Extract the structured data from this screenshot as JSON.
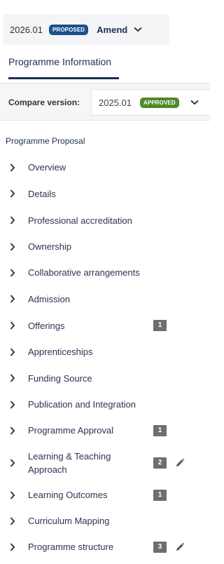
{
  "version_selector": {
    "version": "2026.01",
    "status_badge": "PROPOSED",
    "action_label": "Amend",
    "icon": "chevron-down-icon"
  },
  "tab": {
    "label": "Programme Information"
  },
  "compare": {
    "label": "Compare version:",
    "version": "2025.01",
    "status_badge": "APPROVED",
    "icon": "chevron-down-icon"
  },
  "nav": {
    "section_title": "Programme Proposal",
    "items": [
      {
        "label": "Overview",
        "count": "",
        "editable": false
      },
      {
        "label": "Details",
        "count": "",
        "editable": false
      },
      {
        "label": "Professional accreditation",
        "count": "",
        "editable": false
      },
      {
        "label": "Ownership",
        "count": "",
        "editable": false
      },
      {
        "label": "Collaborative arrangements",
        "count": "",
        "editable": false
      },
      {
        "label": "Admission",
        "count": "",
        "editable": false
      },
      {
        "label": "Offerings",
        "count": "1",
        "editable": false
      },
      {
        "label": "Apprenticeships",
        "count": "",
        "editable": false
      },
      {
        "label": "Funding Source",
        "count": "",
        "editable": false
      },
      {
        "label": "Publication and Integration",
        "count": "",
        "editable": false
      },
      {
        "label": "Programme Approval",
        "count": "1",
        "editable": false
      },
      {
        "label": "Learning & Teaching Approach",
        "count": "2",
        "editable": true
      },
      {
        "label": "Learning Outcomes",
        "count": "1",
        "editable": false
      },
      {
        "label": "Curriculum Mapping",
        "count": "",
        "editable": false
      },
      {
        "label": "Programme structure",
        "count": "3",
        "editable": true
      }
    ]
  },
  "colors": {
    "proposed_badge": "#1d4f8b",
    "approved_badge": "#4e8a2c",
    "navy_text": "#1f2f52",
    "count_badge": "#6e6e6e"
  }
}
